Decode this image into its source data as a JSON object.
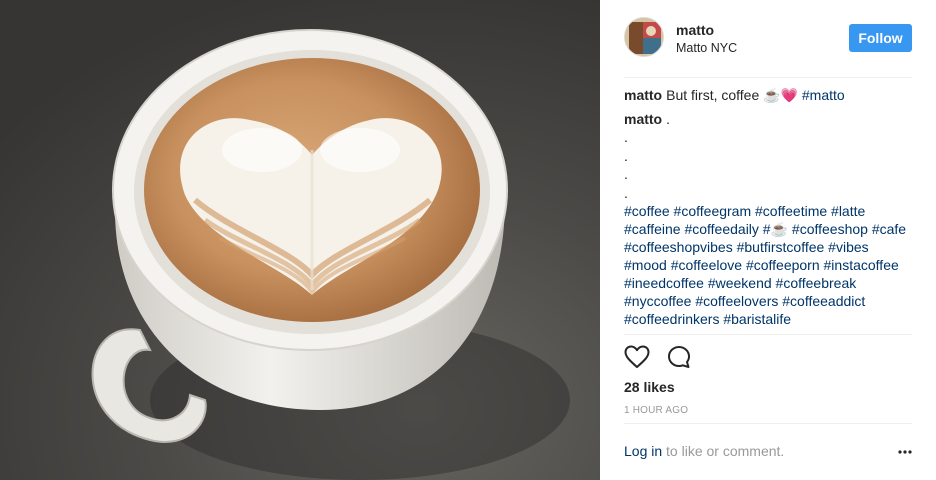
{
  "post": {
    "image_alt": "latte art coffee cup",
    "user": {
      "username": "matto",
      "location": "Matto NYC",
      "follow_label": "Follow"
    },
    "caption": {
      "username": "matto",
      "text": "But first, coffee ☕💗",
      "hashtag": "#matto"
    },
    "second_comment": {
      "username": "matto",
      "text": "."
    },
    "dots": [
      ".",
      ".",
      ".",
      "."
    ],
    "hashtags_text": "#coffee #coffeegram #coffeetime #latte #caffeine #coffeedaily #☕ #coffeeshop #cafe #coffeeshopvibes #butfirstcoffee #vibes #mood #coffeelove #coffeeporn #instacoffee #ineedcoffee #weekend #coffeebreak #nyccoffee #coffeelovers #coffeeaddict #coffeedrinkers #baristalife",
    "likes": "28 likes",
    "time_ago": "1 hour ago",
    "login": {
      "link_label": "Log in",
      "suffix": " to like or comment."
    },
    "icons": {
      "like": "heart-icon",
      "comment": "comment-bubble-icon",
      "more": "more-options-icon"
    },
    "colors": {
      "follow_button": "#3897f0",
      "hashtag": "#003569",
      "muted": "#999999"
    }
  }
}
